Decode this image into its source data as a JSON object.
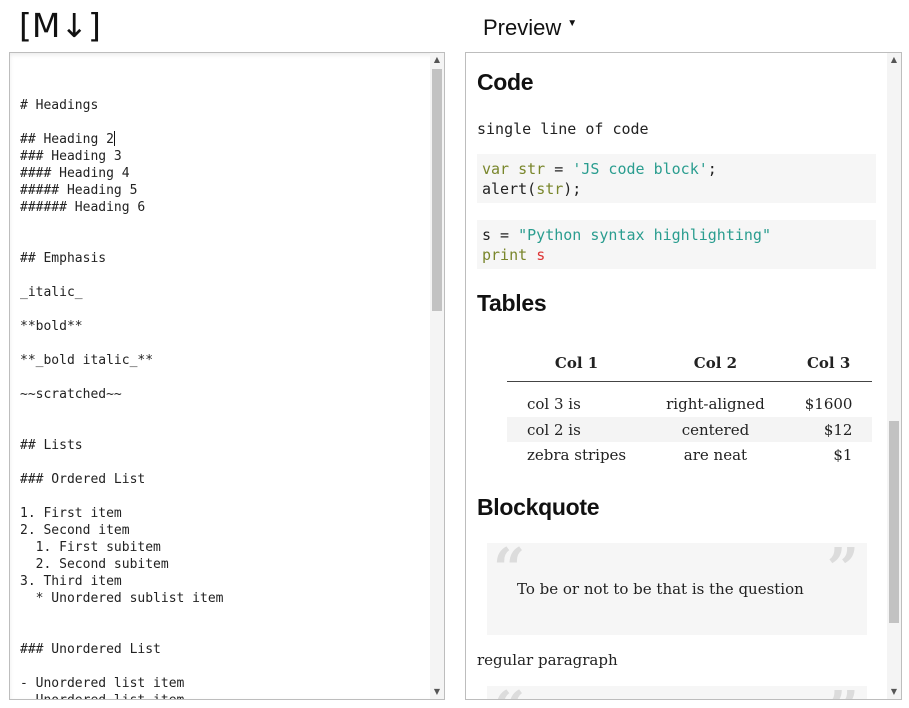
{
  "header": {
    "logo": "[M↓]",
    "preview_label": "Preview",
    "preview_caret": "▼"
  },
  "editor": {
    "lines": [
      "",
      "# Headings",
      "",
      "## Heading 2",
      "### Heading 3",
      "#### Heading 4",
      "##### Heading 5",
      "###### Heading 6",
      "",
      "",
      "## Emphasis",
      "",
      "_italic_",
      "",
      "**bold**",
      "",
      "**_bold italic_**",
      "",
      "~~scratched~~",
      "",
      "",
      "## Lists",
      "",
      "### Ordered List",
      "",
      "1. First item",
      "2. Second item",
      "  1. First subitem",
      "  2. Second subitem",
      "3. Third item",
      "  * Unordered sublist item",
      "",
      "",
      "### Unordered List",
      "",
      "- Unordered list item",
      "- Unordered list item"
    ]
  },
  "preview": {
    "code_heading": "Code",
    "inline_code": "single line of code",
    "js_block": {
      "kw": "var",
      "name": "str",
      "eq": " = ",
      "str": "'JS code block'",
      "semi": ";",
      "line2_fn": "alert(",
      "line2_arg": "str",
      "line2_end": ");"
    },
    "py_block": {
      "lhs": "s = ",
      "str": "\"Python syntax highlighting\"",
      "kw": "print",
      "arg": "s"
    },
    "tables_heading": "Tables",
    "table": {
      "headers": [
        "Col 1",
        "Col 2",
        "Col 3"
      ],
      "rows": [
        [
          "col 3 is",
          "right-aligned",
          "$1600"
        ],
        [
          "col 2 is",
          "centered",
          "$12"
        ],
        [
          "zebra stripes",
          "are neat",
          "$1"
        ]
      ]
    },
    "blockquote_heading": "Blockquote",
    "quote_open": "“",
    "quote_close": "”",
    "quote_text": "To be or not to be that is the question",
    "regular_paragraph": "regular paragraph"
  },
  "colors": {
    "code_var": "#79862b",
    "code_string": "#2a9d8f",
    "code_error": "#dd3333"
  }
}
